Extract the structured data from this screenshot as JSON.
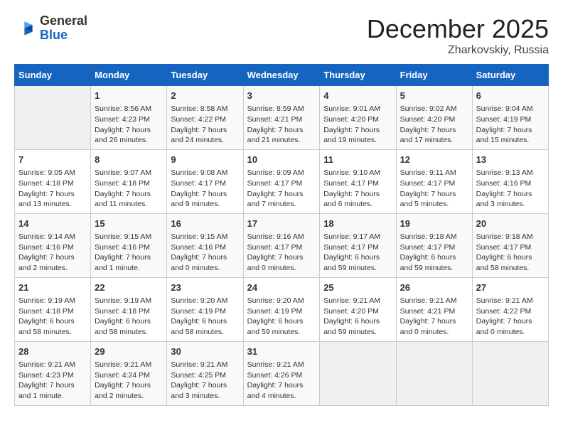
{
  "logo": {
    "general": "General",
    "blue": "Blue"
  },
  "header": {
    "month": "December 2025",
    "location": "Zharkovskiy, Russia"
  },
  "weekdays": [
    "Sunday",
    "Monday",
    "Tuesday",
    "Wednesday",
    "Thursday",
    "Friday",
    "Saturday"
  ],
  "weeks": [
    [
      {
        "day": "",
        "info": ""
      },
      {
        "day": "1",
        "info": "Sunrise: 8:56 AM\nSunset: 4:23 PM\nDaylight: 7 hours\nand 26 minutes."
      },
      {
        "day": "2",
        "info": "Sunrise: 8:58 AM\nSunset: 4:22 PM\nDaylight: 7 hours\nand 24 minutes."
      },
      {
        "day": "3",
        "info": "Sunrise: 8:59 AM\nSunset: 4:21 PM\nDaylight: 7 hours\nand 21 minutes."
      },
      {
        "day": "4",
        "info": "Sunrise: 9:01 AM\nSunset: 4:20 PM\nDaylight: 7 hours\nand 19 minutes."
      },
      {
        "day": "5",
        "info": "Sunrise: 9:02 AM\nSunset: 4:20 PM\nDaylight: 7 hours\nand 17 minutes."
      },
      {
        "day": "6",
        "info": "Sunrise: 9:04 AM\nSunset: 4:19 PM\nDaylight: 7 hours\nand 15 minutes."
      }
    ],
    [
      {
        "day": "7",
        "info": "Sunrise: 9:05 AM\nSunset: 4:18 PM\nDaylight: 7 hours\nand 13 minutes."
      },
      {
        "day": "8",
        "info": "Sunrise: 9:07 AM\nSunset: 4:18 PM\nDaylight: 7 hours\nand 11 minutes."
      },
      {
        "day": "9",
        "info": "Sunrise: 9:08 AM\nSunset: 4:17 PM\nDaylight: 7 hours\nand 9 minutes."
      },
      {
        "day": "10",
        "info": "Sunrise: 9:09 AM\nSunset: 4:17 PM\nDaylight: 7 hours\nand 7 minutes."
      },
      {
        "day": "11",
        "info": "Sunrise: 9:10 AM\nSunset: 4:17 PM\nDaylight: 7 hours\nand 6 minutes."
      },
      {
        "day": "12",
        "info": "Sunrise: 9:11 AM\nSunset: 4:17 PM\nDaylight: 7 hours\nand 5 minutes."
      },
      {
        "day": "13",
        "info": "Sunrise: 9:13 AM\nSunset: 4:16 PM\nDaylight: 7 hours\nand 3 minutes."
      }
    ],
    [
      {
        "day": "14",
        "info": "Sunrise: 9:14 AM\nSunset: 4:16 PM\nDaylight: 7 hours\nand 2 minutes."
      },
      {
        "day": "15",
        "info": "Sunrise: 9:15 AM\nSunset: 4:16 PM\nDaylight: 7 hours\nand 1 minute."
      },
      {
        "day": "16",
        "info": "Sunrise: 9:15 AM\nSunset: 4:16 PM\nDaylight: 7 hours\nand 0 minutes."
      },
      {
        "day": "17",
        "info": "Sunrise: 9:16 AM\nSunset: 4:17 PM\nDaylight: 7 hours\nand 0 minutes."
      },
      {
        "day": "18",
        "info": "Sunrise: 9:17 AM\nSunset: 4:17 PM\nDaylight: 6 hours\nand 59 minutes."
      },
      {
        "day": "19",
        "info": "Sunrise: 9:18 AM\nSunset: 4:17 PM\nDaylight: 6 hours\nand 59 minutes."
      },
      {
        "day": "20",
        "info": "Sunrise: 9:18 AM\nSunset: 4:17 PM\nDaylight: 6 hours\nand 58 minutes."
      }
    ],
    [
      {
        "day": "21",
        "info": "Sunrise: 9:19 AM\nSunset: 4:18 PM\nDaylight: 6 hours\nand 58 minutes."
      },
      {
        "day": "22",
        "info": "Sunrise: 9:19 AM\nSunset: 4:18 PM\nDaylight: 6 hours\nand 58 minutes."
      },
      {
        "day": "23",
        "info": "Sunrise: 9:20 AM\nSunset: 4:19 PM\nDaylight: 6 hours\nand 58 minutes."
      },
      {
        "day": "24",
        "info": "Sunrise: 9:20 AM\nSunset: 4:19 PM\nDaylight: 6 hours\nand 59 minutes."
      },
      {
        "day": "25",
        "info": "Sunrise: 9:21 AM\nSunset: 4:20 PM\nDaylight: 6 hours\nand 59 minutes."
      },
      {
        "day": "26",
        "info": "Sunrise: 9:21 AM\nSunset: 4:21 PM\nDaylight: 7 hours\nand 0 minutes."
      },
      {
        "day": "27",
        "info": "Sunrise: 9:21 AM\nSunset: 4:22 PM\nDaylight: 7 hours\nand 0 minutes."
      }
    ],
    [
      {
        "day": "28",
        "info": "Sunrise: 9:21 AM\nSunset: 4:23 PM\nDaylight: 7 hours\nand 1 minute."
      },
      {
        "day": "29",
        "info": "Sunrise: 9:21 AM\nSunset: 4:24 PM\nDaylight: 7 hours\nand 2 minutes."
      },
      {
        "day": "30",
        "info": "Sunrise: 9:21 AM\nSunset: 4:25 PM\nDaylight: 7 hours\nand 3 minutes."
      },
      {
        "day": "31",
        "info": "Sunrise: 9:21 AM\nSunset: 4:26 PM\nDaylight: 7 hours\nand 4 minutes."
      },
      {
        "day": "",
        "info": ""
      },
      {
        "day": "",
        "info": ""
      },
      {
        "day": "",
        "info": ""
      }
    ]
  ]
}
